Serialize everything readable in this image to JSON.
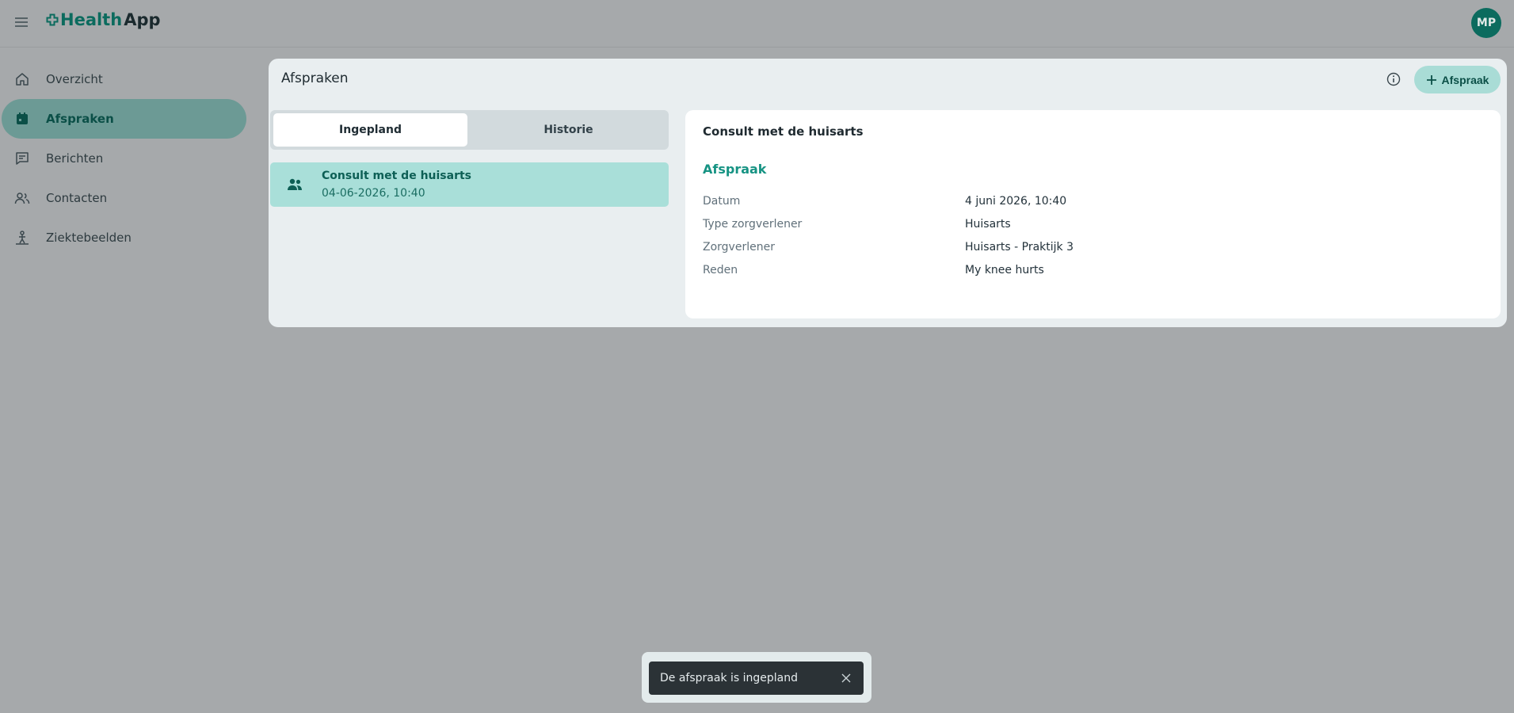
{
  "header": {
    "logo_health": "Health",
    "logo_app": "App",
    "avatar_initials": "MP"
  },
  "sidebar": {
    "items": [
      {
        "label": "Overzicht",
        "icon": "home-icon"
      },
      {
        "label": "Afspraken",
        "icon": "calendar-icon",
        "active": true
      },
      {
        "label": "Berichten",
        "icon": "chat-icon"
      },
      {
        "label": "Contacten",
        "icon": "people-icon"
      },
      {
        "label": "Ziektebeelden",
        "icon": "condition-icon"
      }
    ]
  },
  "main": {
    "title": "Afspraken",
    "add_button_label": "Afspraak",
    "tabs": [
      {
        "label": "Ingepland",
        "selected": true
      },
      {
        "label": "Historie",
        "selected": false
      }
    ],
    "appointments": [
      {
        "title": "Consult met de huisarts",
        "datetime": "04-06-2026, 10:40"
      }
    ]
  },
  "detail": {
    "title": "Consult met de huisarts",
    "section_title": "Afspraak",
    "rows": [
      {
        "label": "Datum",
        "value": "4 juni 2026, 10:40"
      },
      {
        "label": "Type zorgverlener",
        "value": "Huisarts"
      },
      {
        "label": "Zorgverlener",
        "value": "Huisarts - Praktijk 3"
      },
      {
        "label": "Reden",
        "value": "My knee hurts"
      }
    ]
  },
  "snackbar": {
    "message": "De afspraak is ingepland"
  },
  "colors": {
    "brand": "#0b6b5e",
    "accent": "#169383",
    "selected_card": "#a9dfd9",
    "overlay": "#a6a9ab"
  }
}
